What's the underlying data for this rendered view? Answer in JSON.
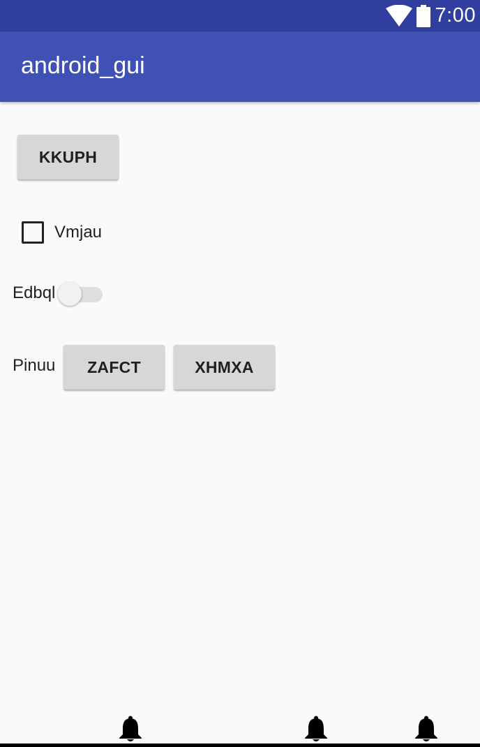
{
  "status_bar": {
    "time": "7:00",
    "icons": [
      "wifi-icon",
      "battery-icon"
    ],
    "color": "#303f9f"
  },
  "app_bar": {
    "title": "android_gui",
    "color": "#3f51b5"
  },
  "content": {
    "top_button": {
      "label": "KKUPH"
    },
    "checkbox": {
      "label": "Vmjau",
      "checked": false
    },
    "switch": {
      "label": "Edbql",
      "on": false
    },
    "button_group": {
      "label": "Pinuu",
      "buttons": [
        {
          "label": "ZAFCT"
        },
        {
          "label": "XHMXA"
        }
      ]
    }
  },
  "bottom": {
    "icons": [
      "bell-icon",
      "bell-icon",
      "bell-icon"
    ]
  }
}
